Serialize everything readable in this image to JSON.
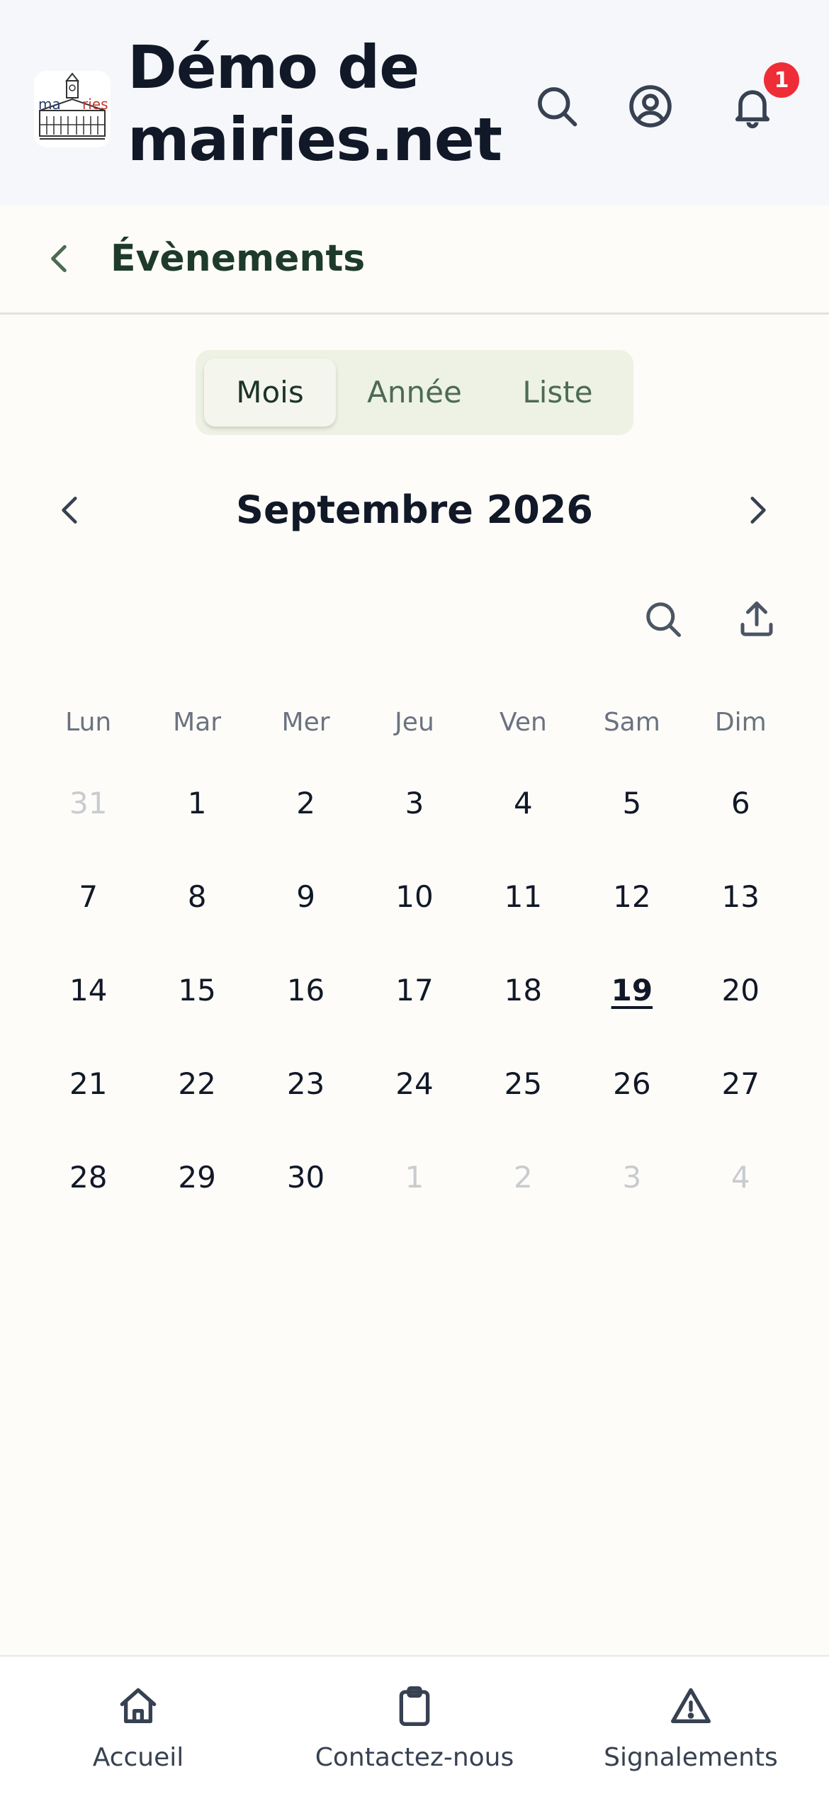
{
  "header": {
    "title": "Démo de mairies.net",
    "logo_text": "mairies",
    "notification_count": "1",
    "icons": [
      "search-icon",
      "user-circle-icon",
      "bell-icon"
    ]
  },
  "subheader": {
    "title": "Évènements",
    "back_icon": "chevron-left-icon"
  },
  "view_switch": {
    "options": [
      "Mois",
      "Année",
      "Liste"
    ],
    "selected": "Mois"
  },
  "calendar": {
    "month_label": "Septembre 2026",
    "weekdays": [
      "Lun",
      "Mar",
      "Mer",
      "Jeu",
      "Ven",
      "Sam",
      "Dim"
    ],
    "weeks": [
      [
        "31",
        "1",
        "2",
        "3",
        "4",
        "5",
        "6"
      ],
      [
        "7",
        "8",
        "9",
        "10",
        "11",
        "12",
        "13"
      ],
      [
        "14",
        "15",
        "16",
        "17",
        "18",
        "19",
        "20"
      ],
      [
        "21",
        "22",
        "23",
        "24",
        "25",
        "26",
        "27"
      ],
      [
        "28",
        "29",
        "30",
        "1",
        "2",
        "3",
        "4"
      ]
    ],
    "today": "19",
    "tools": [
      "search-icon",
      "upload-icon"
    ]
  },
  "bottom_nav": {
    "items": [
      {
        "label": "Accueil",
        "icon": "home-icon"
      },
      {
        "label": "Contactez-nous",
        "icon": "clipboard-icon"
      },
      {
        "label": "Signalements",
        "icon": "warning-icon"
      }
    ]
  },
  "colors": {
    "accent": "#1e3a2b",
    "badge": "#ef2d36",
    "header_bg": "#f5f7fa",
    "page_bg": "#fdfcf8"
  }
}
